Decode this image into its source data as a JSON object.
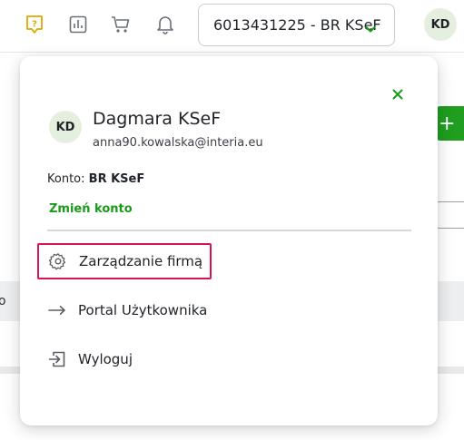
{
  "topbar": {
    "icons": [
      "help-icon",
      "reports-icon",
      "cart-icon",
      "bell-icon"
    ],
    "account_select_value": "6013431225 - BR KSeF",
    "avatar_initials": "KD"
  },
  "background": {
    "add_button_label": "+",
    "table_header_fragment": "o"
  },
  "panel": {
    "avatar_initials": "KD",
    "user_name": "Dagmara KSeF",
    "user_email": "anna90.kowalska@interia.eu",
    "account_label": "Konto:",
    "account_name": "BR KSeF",
    "switch_account": "Zmień konto",
    "menu": {
      "company_management": "Zarządzanie firmą",
      "user_portal": "Portal Użytkownika",
      "logout": "Wyloguj"
    }
  },
  "colors": {
    "accent_green": "#1a9a1a",
    "help_icon_yellow": "#e0a800",
    "highlight_red": "#d6154f"
  }
}
